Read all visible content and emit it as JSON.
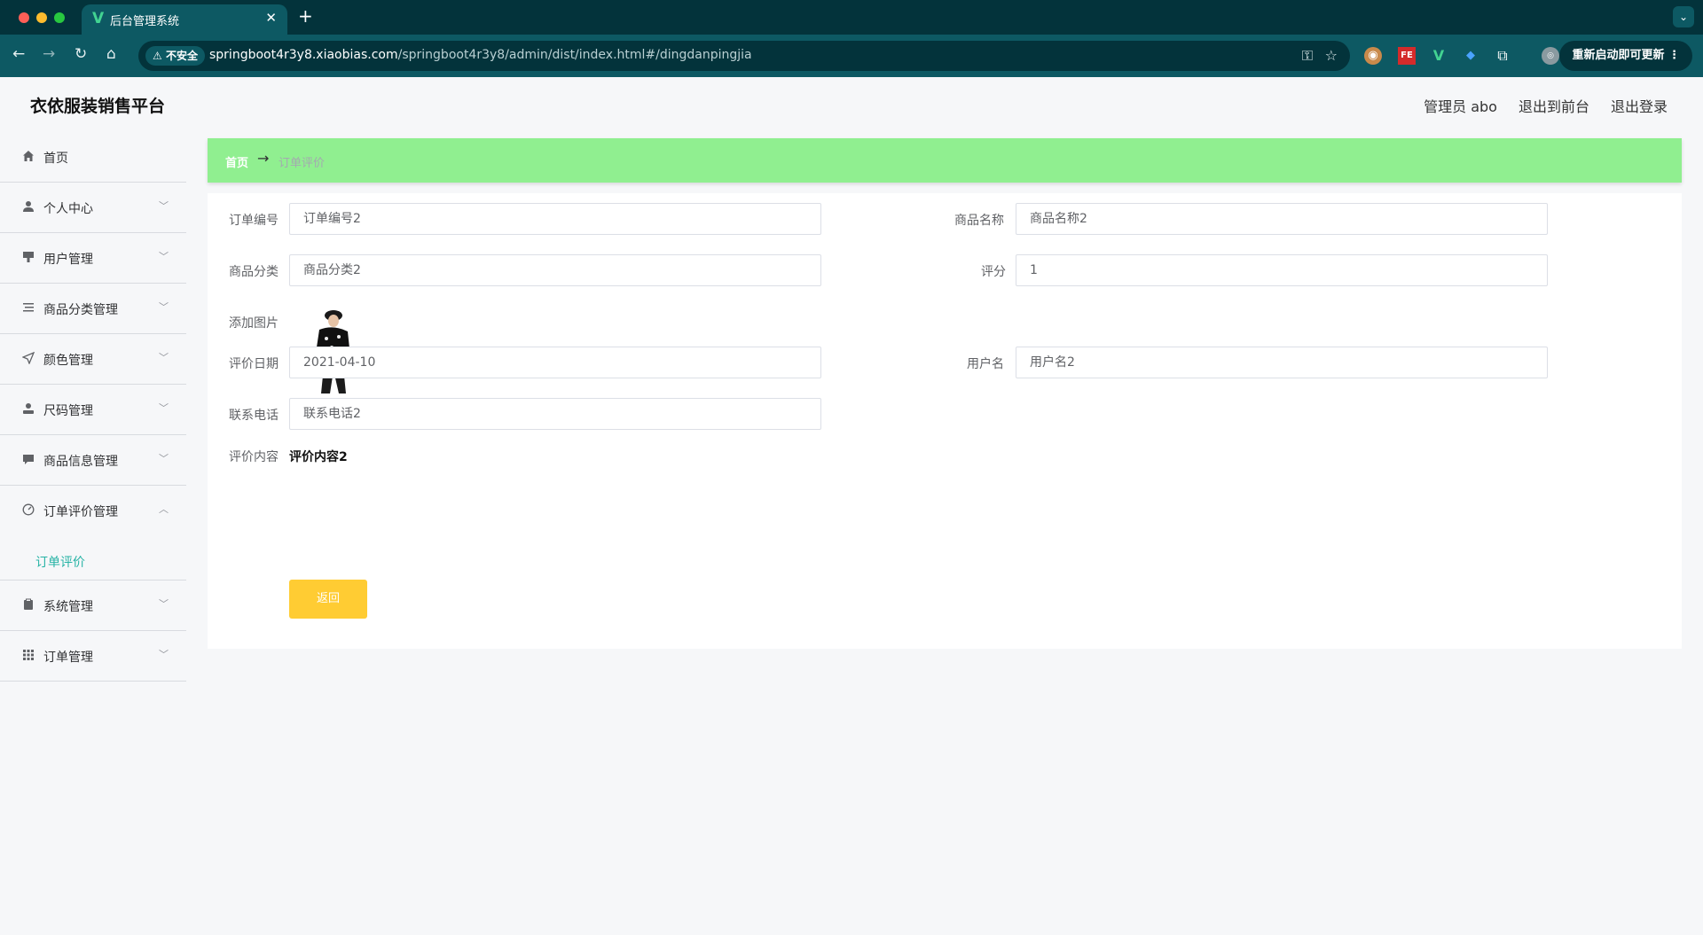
{
  "browser": {
    "tab_title": "后台管理系统",
    "insecure_label": "不安全",
    "url_host": "springboot4r3y8.xiaobias.com",
    "url_path": "/springboot4r3y8/admin/dist/index.html#/dingdanpingjia",
    "update_button": "重新启动即可更新"
  },
  "header": {
    "site_title": "衣依服装销售平台",
    "user_label": "管理员 abo",
    "to_front": "退出到前台",
    "logout": "退出登录"
  },
  "sidebar": {
    "items": [
      {
        "label": "首页",
        "icon": "home-icon"
      },
      {
        "label": "个人中心",
        "icon": "user-icon"
      },
      {
        "label": "用户管理",
        "icon": "brush-icon"
      },
      {
        "label": "商品分类管理",
        "icon": "list-icon"
      },
      {
        "label": "颜色管理",
        "icon": "send-icon"
      },
      {
        "label": "尺码管理",
        "icon": "user-solid-icon"
      },
      {
        "label": "商品信息管理",
        "icon": "chat-icon"
      },
      {
        "label": "订单评价管理",
        "icon": "gauge-icon",
        "sub": "订单评价"
      },
      {
        "label": "系统管理",
        "icon": "clipboard-icon"
      },
      {
        "label": "订单管理",
        "icon": "grid-icon"
      }
    ]
  },
  "breadcrumb": {
    "home": "首页",
    "separator": "→",
    "current": "订单评价"
  },
  "form": {
    "order_no_label": "订单编号",
    "order_no_value": "订单编号2",
    "product_name_label": "商品名称",
    "product_name_value": "商品名称2",
    "category_label": "商品分类",
    "category_value": "商品分类2",
    "score_label": "评分",
    "score_value": "1",
    "image_label": "添加图片",
    "date_label": "评价日期",
    "date_value": "2021-04-10",
    "username_label": "用户名",
    "username_value": "用户名2",
    "phone_label": "联系电话",
    "phone_value": "联系电话2",
    "content_label": "评价内容",
    "content_value": "评价内容2",
    "back_button": "返回"
  },
  "colors": {
    "breadcrumb_bg": "#90ef90",
    "active_menu": "#26b3a5",
    "back_button": "#ffcc33"
  }
}
